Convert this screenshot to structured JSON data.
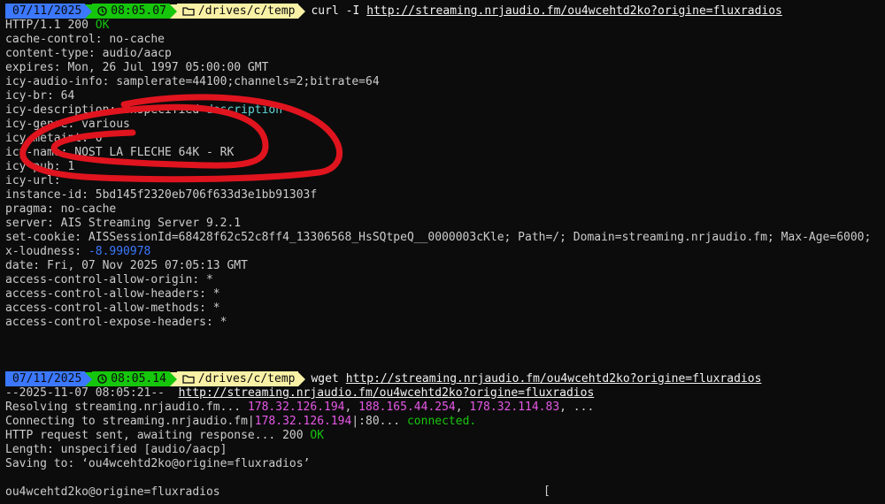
{
  "prompt1": {
    "date": "07/11/2025",
    "time": "08:05.07",
    "path": "/drives/c/temp",
    "command": "curl -I",
    "url": "http://streaming.nrjaudio.fm/ou4wcehtd2ko?origine=fluxradios"
  },
  "headers": [
    {
      "pre": "HTTP/1.1 200 ",
      "hl": "OK",
      "hl_class": "ok",
      "post": ""
    },
    {
      "pre": "cache-control: no-cache",
      "hl": "",
      "hl_class": "",
      "post": ""
    },
    {
      "pre": "content-type: audio/aacp",
      "hl": "",
      "hl_class": "",
      "post": ""
    },
    {
      "pre": "expires: Mon, 26 Jul 1997 05:00:00 GMT",
      "hl": "",
      "hl_class": "",
      "post": ""
    },
    {
      "pre": "icy-audio-info: samplerate=44100;channels=2;bitrate=64",
      "hl": "",
      "hl_class": "",
      "post": ""
    },
    {
      "pre": "icy-br: 64",
      "hl": "",
      "hl_class": "",
      "post": ""
    },
    {
      "pre": "icy-description: Unspecified ",
      "hl": "description",
      "hl_class": "blue",
      "post": ""
    },
    {
      "pre": "icy-genre: various",
      "hl": "",
      "hl_class": "",
      "post": ""
    },
    {
      "pre": "icy-metaint: 0",
      "hl": "",
      "hl_class": "",
      "post": ""
    },
    {
      "pre": "icy-name: NOST LA FLECHE 64K - RK",
      "hl": "",
      "hl_class": "",
      "post": ""
    },
    {
      "pre": "icy-pub: 1",
      "hl": "",
      "hl_class": "",
      "post": ""
    },
    {
      "pre": "icy-url:",
      "hl": "",
      "hl_class": "",
      "post": ""
    },
    {
      "pre": "instance-id: 5bd145f2320eb706f633d3e1bb91303f",
      "hl": "",
      "hl_class": "",
      "post": ""
    },
    {
      "pre": "pragma: no-cache",
      "hl": "",
      "hl_class": "",
      "post": ""
    },
    {
      "pre": "server: AIS Streaming Server 9.2.1",
      "hl": "",
      "hl_class": "",
      "post": ""
    },
    {
      "pre": "set-cookie: AISSessionId=68428f62c52c8ff4_13306568_HsSQtpeQ__0000003cKle; Path=/; Domain=streaming.nrjaudio.fm; Max-Age=6000;",
      "hl": "",
      "hl_class": "",
      "post": ""
    },
    {
      "pre": "x-loudness: ",
      "hl": "-8.990978",
      "hl_class": "num",
      "post": ""
    },
    {
      "pre": "date: Fri, 07 Nov 2025 07:05:13 GMT",
      "hl": "",
      "hl_class": "",
      "post": ""
    },
    {
      "pre": "access-control-allow-origin: *",
      "hl": "",
      "hl_class": "",
      "post": ""
    },
    {
      "pre": "access-control-allow-headers: *",
      "hl": "",
      "hl_class": "",
      "post": ""
    },
    {
      "pre": "access-control-allow-methods: *",
      "hl": "",
      "hl_class": "",
      "post": ""
    },
    {
      "pre": "access-control-expose-headers: *",
      "hl": "",
      "hl_class": "",
      "post": ""
    }
  ],
  "prompt2": {
    "date": "07/11/2025",
    "time": "08:05.14",
    "path": "/drives/c/temp",
    "command": "wget",
    "url": "http://streaming.nrjaudio.fm/ou4wcehtd2ko?origine=fluxradios"
  },
  "wget": {
    "line1_pre": "--2025-11-07 08:05:21--  ",
    "line1_url": "http://streaming.nrjaudio.fm/ou4wcehtd2ko?origine=fluxradios",
    "resolving_pre": "Resolving streaming.nrjaudio.fm... ",
    "ip1": "178.32.126.194",
    "sep": ", ",
    "ip2": "188.165.44.254",
    "ip3": "178.32.114.83",
    "resolving_post": ", ...",
    "connect_pre": "Connecting to streaming.nrjaudio.fm|",
    "connect_ip": "178.32.126.194",
    "connect_mid": "|:80... ",
    "connected": "connected.",
    "request_pre": "HTTP request sent, awaiting response... 200 ",
    "request_ok": "OK",
    "length": "Length: unspecified [audio/aacp]",
    "saving": "Saving to: ‘ou4wcehtd2ko@origine=fluxradios’",
    "progress_name": "ou4wcehtd2ko@origine=fluxradios",
    "progress_bracket": "["
  },
  "colors": {
    "date_segment": "#3b78ff",
    "time_segment": "#16c60c",
    "path_segment": "#f9f1a5",
    "annotation": "#e0141e"
  },
  "icons": {
    "time": "clock-icon",
    "path": "folder-icon"
  }
}
